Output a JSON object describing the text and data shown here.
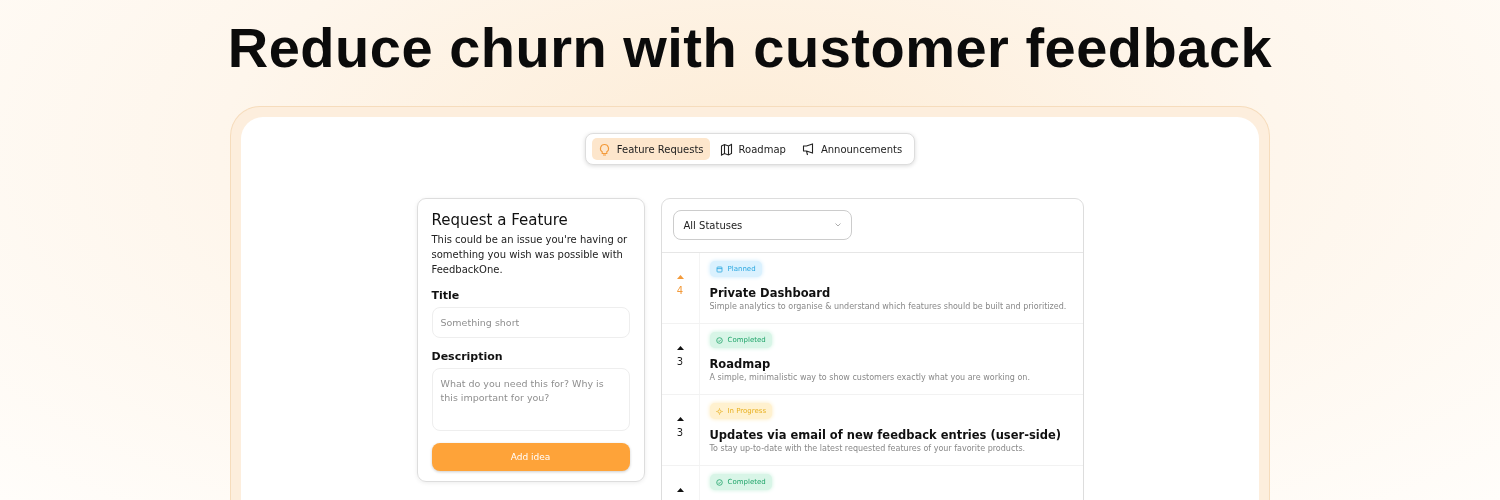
{
  "headline": "Reduce churn with customer feedback",
  "tabs": [
    {
      "label": "Feature Requests",
      "selected": true
    },
    {
      "label": "Roadmap",
      "selected": false
    },
    {
      "label": "Announcements",
      "selected": false
    }
  ],
  "request_form": {
    "title": "Request a Feature",
    "description": "This could be an issue you're having or something you wish was possible with FeedbackOne.",
    "fields": [
      {
        "label": "Title",
        "placeholder": "Something short",
        "kind": "input"
      },
      {
        "label": "Description",
        "placeholder": "What do you need this for? Why is this important for you?",
        "kind": "textarea"
      }
    ],
    "submit": "Add idea"
  },
  "filter": {
    "value": "All Statuses"
  },
  "requests": [
    {
      "status": "Planned",
      "kind": "planned",
      "votes": "4",
      "voted": true,
      "title": "Private Dashboard",
      "description": "Simple analytics to organise & understand which features should be built and prioritized."
    },
    {
      "status": "Completed",
      "kind": "completed",
      "votes": "3",
      "voted": false,
      "title": "Roadmap",
      "description": "A simple, minimalistic way to show customers exactly what you are working on."
    },
    {
      "status": "In Progress",
      "kind": "in_progress",
      "votes": "3",
      "voted": false,
      "title": "Updates via email of new feedback entries (user-side)",
      "description": "To stay up-to-date with the latest requested features of your favorite products."
    },
    {
      "status": "Completed",
      "kind": "completed",
      "voted": false
    }
  ]
}
